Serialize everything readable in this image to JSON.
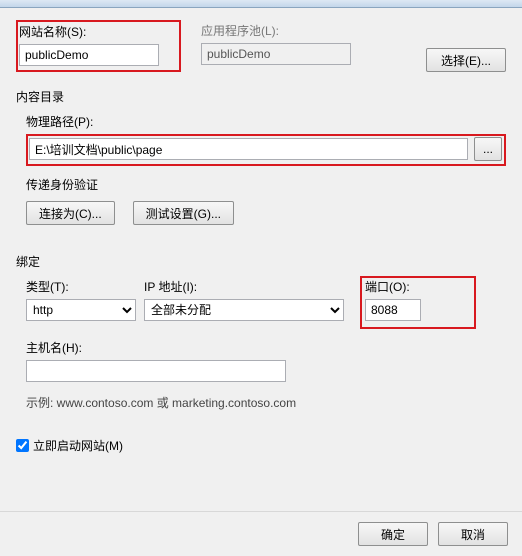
{
  "labels": {
    "site_name": "网站名称(S):",
    "app_pool": "应用程序池(L):",
    "select_btn": "选择(E)...",
    "content_dir": "内容目录",
    "physical_path": "物理路径(P):",
    "browse_btn": "...",
    "auth_title": "传递身份验证",
    "connect_as": "连接为(C)...",
    "test_settings": "测试设置(G)...",
    "binding": "绑定",
    "type": "类型(T):",
    "ip_address": "IP 地址(I):",
    "port": "端口(O):",
    "hostname": "主机名(H):",
    "example": "示例: www.contoso.com 或 marketing.contoso.com",
    "auto_start": "立即启动网站(M)",
    "ok": "确定",
    "cancel": "取消"
  },
  "values": {
    "site_name": "publicDemo",
    "app_pool": "publicDemo",
    "physical_path": "E:\\培训文档\\public\\page",
    "type": "http",
    "ip": "全部未分配",
    "port": "8088",
    "hostname": "",
    "auto_start_checked": true
  }
}
